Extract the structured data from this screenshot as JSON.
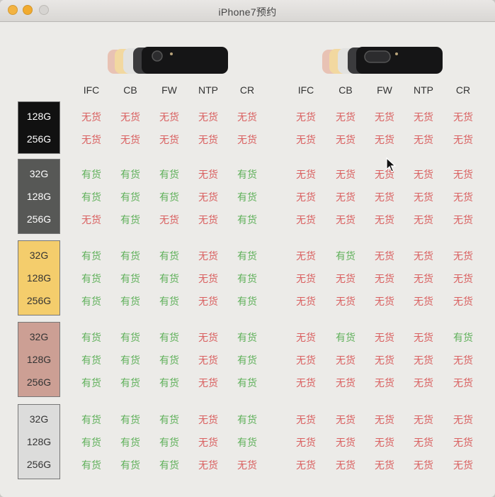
{
  "window": {
    "title": "iPhone7预约"
  },
  "columns": [
    "IFC",
    "CB",
    "FW",
    "NTP",
    "CR"
  ],
  "colors": {
    "in_stock": "#5fb05a",
    "out_of_stock": "#d95f5f"
  },
  "groups": [
    {
      "name": "jet-black",
      "bg": "#111111",
      "fg": "#ffffff",
      "capacities": [
        "128G",
        "256G"
      ],
      "left": [
        [
          "无货",
          "无货",
          "无货",
          "无货",
          "无货"
        ],
        [
          "无货",
          "无货",
          "无货",
          "无货",
          "无货"
        ]
      ],
      "right": [
        [
          "无货",
          "无货",
          "无货",
          "无货",
          "无货"
        ],
        [
          "无货",
          "无货",
          "无货",
          "无货",
          "无货"
        ]
      ]
    },
    {
      "name": "black",
      "bg": "#575856",
      "fg": "#ffffff",
      "capacities": [
        "32G",
        "128G",
        "256G"
      ],
      "left": [
        [
          "有货",
          "有货",
          "有货",
          "无货",
          "有货"
        ],
        [
          "有货",
          "有货",
          "有货",
          "无货",
          "有货"
        ],
        [
          "无货",
          "有货",
          "无货",
          "无货",
          "有货"
        ]
      ],
      "right": [
        [
          "无货",
          "无货",
          "无货",
          "无货",
          "无货"
        ],
        [
          "无货",
          "无货",
          "无货",
          "无货",
          "无货"
        ],
        [
          "无货",
          "无货",
          "无货",
          "无货",
          "无货"
        ]
      ]
    },
    {
      "name": "gold",
      "bg": "#f4cd6c",
      "fg": "#333333",
      "capacities": [
        "32G",
        "128G",
        "256G"
      ],
      "left": [
        [
          "有货",
          "有货",
          "有货",
          "无货",
          "有货"
        ],
        [
          "有货",
          "有货",
          "有货",
          "无货",
          "有货"
        ],
        [
          "有货",
          "有货",
          "有货",
          "无货",
          "有货"
        ]
      ],
      "right": [
        [
          "无货",
          "有货",
          "无货",
          "无货",
          "无货"
        ],
        [
          "无货",
          "无货",
          "无货",
          "无货",
          "无货"
        ],
        [
          "无货",
          "无货",
          "无货",
          "无货",
          "无货"
        ]
      ]
    },
    {
      "name": "rose-gold",
      "bg": "#cc9f94",
      "fg": "#333333",
      "capacities": [
        "32G",
        "128G",
        "256G"
      ],
      "left": [
        [
          "有货",
          "有货",
          "有货",
          "无货",
          "有货"
        ],
        [
          "有货",
          "有货",
          "有货",
          "无货",
          "有货"
        ],
        [
          "有货",
          "有货",
          "有货",
          "无货",
          "有货"
        ]
      ],
      "right": [
        [
          "无货",
          "有货",
          "无货",
          "无货",
          "有货"
        ],
        [
          "无货",
          "无货",
          "无货",
          "无货",
          "无货"
        ],
        [
          "无货",
          "无货",
          "无货",
          "无货",
          "无货"
        ]
      ]
    },
    {
      "name": "silver",
      "bg": "#dcdcdb",
      "fg": "#333333",
      "capacities": [
        "32G",
        "128G",
        "256G"
      ],
      "left": [
        [
          "有货",
          "有货",
          "有货",
          "无货",
          "有货"
        ],
        [
          "有货",
          "有货",
          "有货",
          "无货",
          "有货"
        ],
        [
          "有货",
          "有货",
          "有货",
          "无货",
          "无货"
        ]
      ],
      "right": [
        [
          "无货",
          "无货",
          "无货",
          "无货",
          "无货"
        ],
        [
          "无货",
          "无货",
          "无货",
          "无货",
          "无货"
        ],
        [
          "无货",
          "无货",
          "无货",
          "无货",
          "无货"
        ]
      ]
    }
  ]
}
